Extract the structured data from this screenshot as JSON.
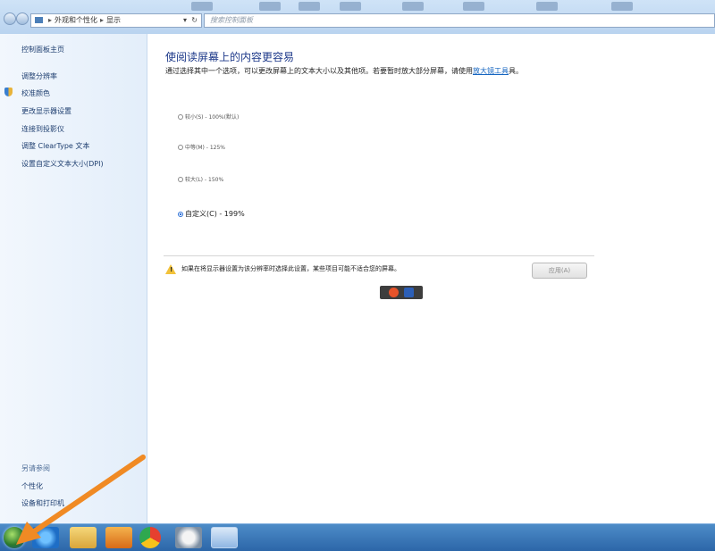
{
  "address_bar": {
    "segments": [
      "外观和个性化",
      "显示"
    ],
    "search_placeholder": "搜索控制面板"
  },
  "sidebar": {
    "home_link": "控制面板主页",
    "links": [
      "调整分辨率",
      "校准颜色",
      "更改显示器设置",
      "连接到投影仪",
      "调整 ClearType 文本",
      "设置自定义文本大小(DPI)"
    ],
    "see_also_heading": "另请参阅",
    "see_also_links": [
      "个性化",
      "设备和打印机"
    ]
  },
  "main": {
    "heading": "使阅读屏幕上的内容更容易",
    "description": "通过选择其中一个选项，可以更改屏幕上的文本大小以及其他项。若要暂时放大部分屏幕，请使用",
    "magnifier_link": "放大镜工具",
    "description_end": "具。",
    "options": [
      {
        "label": "较小(S) - 100%(默认)",
        "selected": false
      },
      {
        "label": "中等(M) - 125%",
        "selected": false
      },
      {
        "label": "较大(L) - 150%",
        "selected": false
      },
      {
        "label": "自定义(C) - 199%",
        "selected": true
      }
    ],
    "warning": "如果在将显示器设置为该分辨率时选择此设置，某些项目可能不适合您的屏幕。",
    "apply_button": "应用(A)"
  },
  "colors": {
    "link": "#1f3f70",
    "heading": "#1e3a8a",
    "arrow": "#f08a24"
  }
}
